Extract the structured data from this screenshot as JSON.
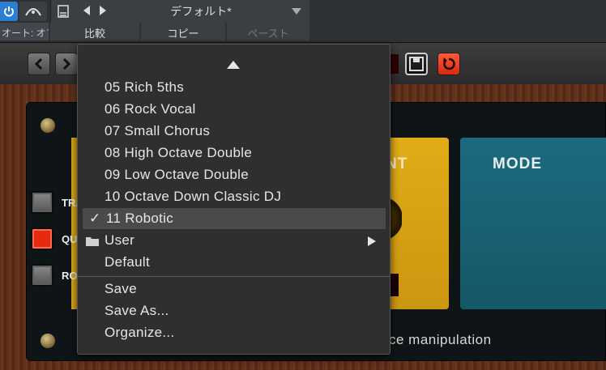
{
  "host": {
    "preset_name": "デフォルト*",
    "auto_label": "オート: オフ",
    "compare_label": "比較",
    "copy_label": "コピー",
    "paste_label": "ペースト"
  },
  "plugin": {
    "param_partial_label": "NT",
    "mode": {
      "title": "MODE",
      "options": [
        "TRANSPOSE",
        "QUANTIZE",
        "ROBOT"
      ],
      "active": "QUANTIZE"
    },
    "led_value": "8",
    "footer_partial": "ce manipulation"
  },
  "menu": {
    "items": [
      "05 Rich 5ths",
      "06 Rock Vocal",
      "07 Small Chorus",
      "08 High Octave Double",
      "09 Low Octave Double",
      "10 Octave Down Classic DJ",
      "11 Robotic",
      "User",
      "Default"
    ],
    "selected": "11 Robotic",
    "actions": [
      "Save",
      "Save As...",
      "Organize..."
    ]
  },
  "colors": {
    "accent_blue": "#2a7fd4",
    "plugin_yellow": "#d9a514",
    "plugin_teal": "#1c6a80",
    "quantize_red": "#e62a10",
    "reset_red": "#e8401f"
  }
}
